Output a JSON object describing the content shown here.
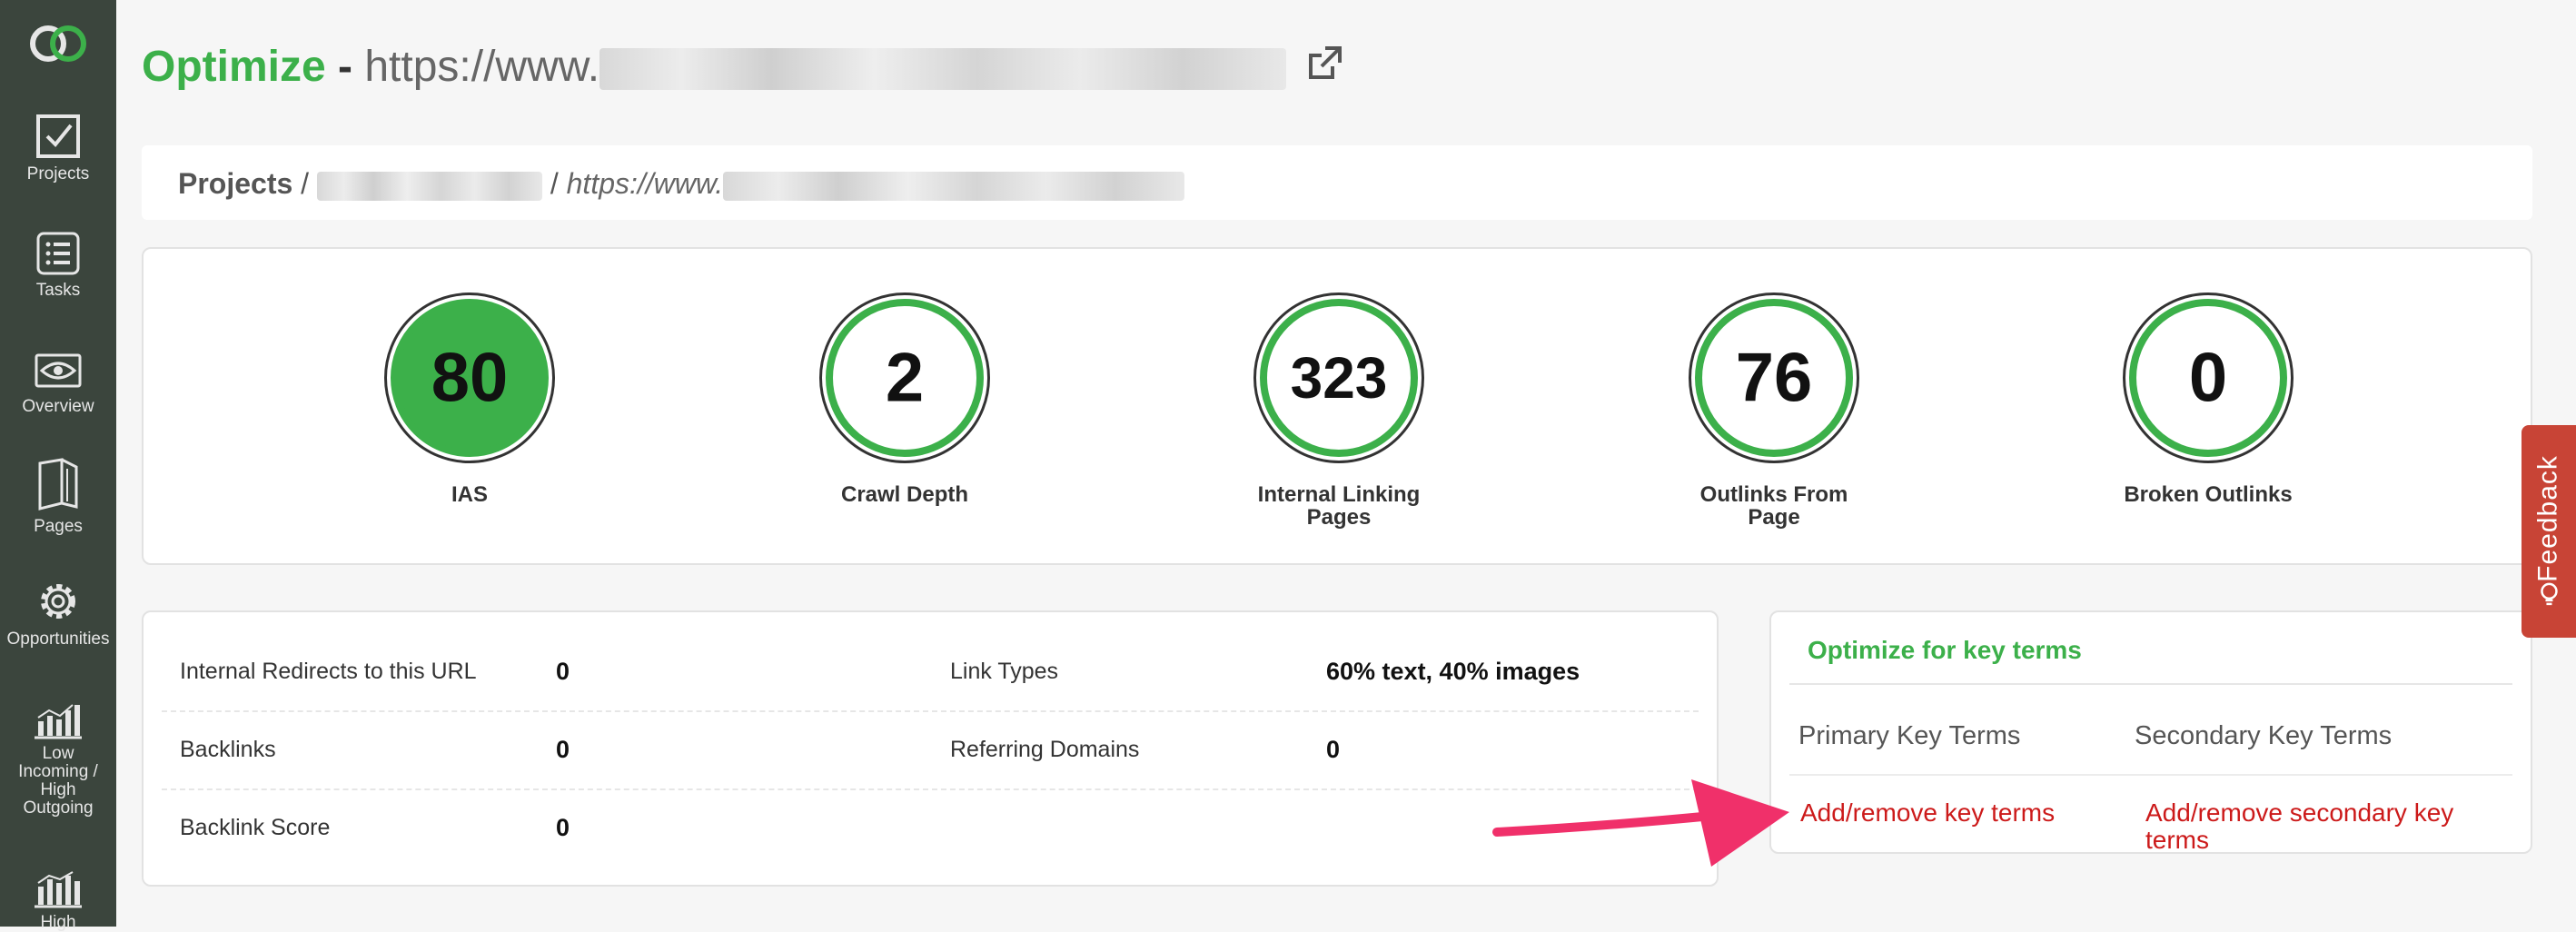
{
  "sidebar": {
    "items": [
      {
        "label": "Projects",
        "icon": "check-square-icon"
      },
      {
        "label": "Tasks",
        "icon": "list-icon"
      },
      {
        "label": "Overview",
        "icon": "eye-icon"
      },
      {
        "label": "Pages",
        "icon": "pages-icon"
      },
      {
        "label": "Opportunities",
        "icon": "gear-icon"
      },
      {
        "label": "Low Incoming / High Outgoing",
        "icon": "bar-chart-icon"
      },
      {
        "label": "High",
        "icon": "bar-chart-icon"
      }
    ]
  },
  "header": {
    "brand": "Optimize",
    "separator": "-",
    "url_prefix": "https://www.",
    "external_link_icon": "external-link-icon"
  },
  "breadcrumb": {
    "projects": "Projects",
    "sep1": "/",
    "sep2": "/",
    "current_prefix": "https://www."
  },
  "metrics": [
    {
      "label": "IAS",
      "value": "80",
      "filled": true
    },
    {
      "label": "Crawl Depth",
      "value": "2",
      "filled": false
    },
    {
      "label": "Internal Linking Pages",
      "value": "323",
      "filled": false
    },
    {
      "label": "Outlinks From Page",
      "value": "76",
      "filled": false
    },
    {
      "label": "Broken Outlinks",
      "value": "0",
      "filled": false
    }
  ],
  "stats": {
    "internal_redirects": {
      "label": "Internal Redirects to this URL",
      "value": "0"
    },
    "link_types": {
      "label": "Link Types",
      "value": "60% text, 40% images"
    },
    "backlinks": {
      "label": "Backlinks",
      "value": "0"
    },
    "referring_domains": {
      "label": "Referring Domains",
      "value": "0"
    },
    "backlink_score": {
      "label": "Backlink Score",
      "value": "0"
    }
  },
  "keyterms": {
    "title": "Optimize for key terms",
    "primary_header": "Primary Key Terms",
    "secondary_header": "Secondary Key Terms",
    "primary_link": "Add/remove key terms",
    "secondary_link": "Add/remove secondary key terms"
  },
  "feedback": {
    "label": "Feedback",
    "icon": "lightbulb-icon"
  },
  "colors": {
    "accent_green": "#3cb04a",
    "sidebar_bg": "#3b453d",
    "link_red": "#cc1a1a",
    "feedback_bg": "#c84436",
    "arrow_pink": "#f0306a"
  }
}
